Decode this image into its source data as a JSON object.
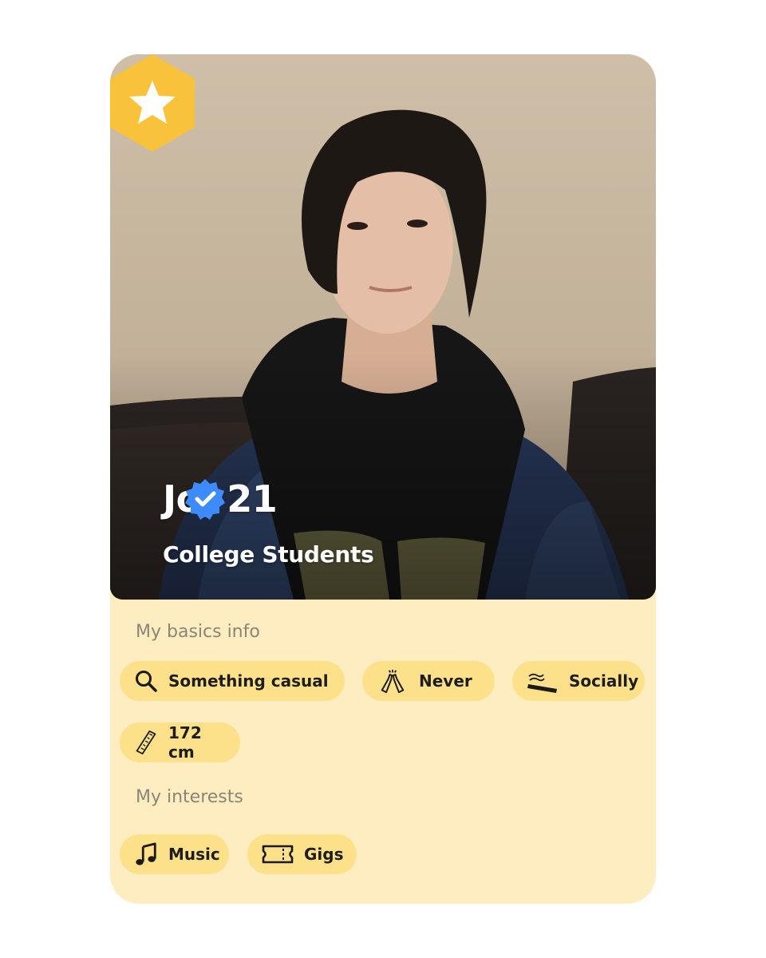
{
  "profile": {
    "name_age": "Jo, 21",
    "tagline": "College Students",
    "verified_icon": "verified-badge-icon",
    "premium_icon": "star-hexagon-icon"
  },
  "basics": {
    "title": "My basics info",
    "chips": [
      {
        "icon": "search-icon",
        "label": "Something casual"
      },
      {
        "icon": "bottles-cheers-icon",
        "label": "Never"
      },
      {
        "icon": "cigarette-icon",
        "label": "Socially"
      },
      {
        "icon": "ruler-icon",
        "label": "172 cm"
      }
    ]
  },
  "interests": {
    "title": "My interests",
    "chips": [
      {
        "icon": "music-note-icon",
        "label": "Music"
      },
      {
        "icon": "ticket-icon",
        "label": "Gigs"
      }
    ]
  },
  "colors": {
    "card_background": "#fdedc0",
    "chip_background": "#fde08a",
    "badge_gold": "#f8c23a",
    "verified_blue": "#3d8bfd"
  }
}
